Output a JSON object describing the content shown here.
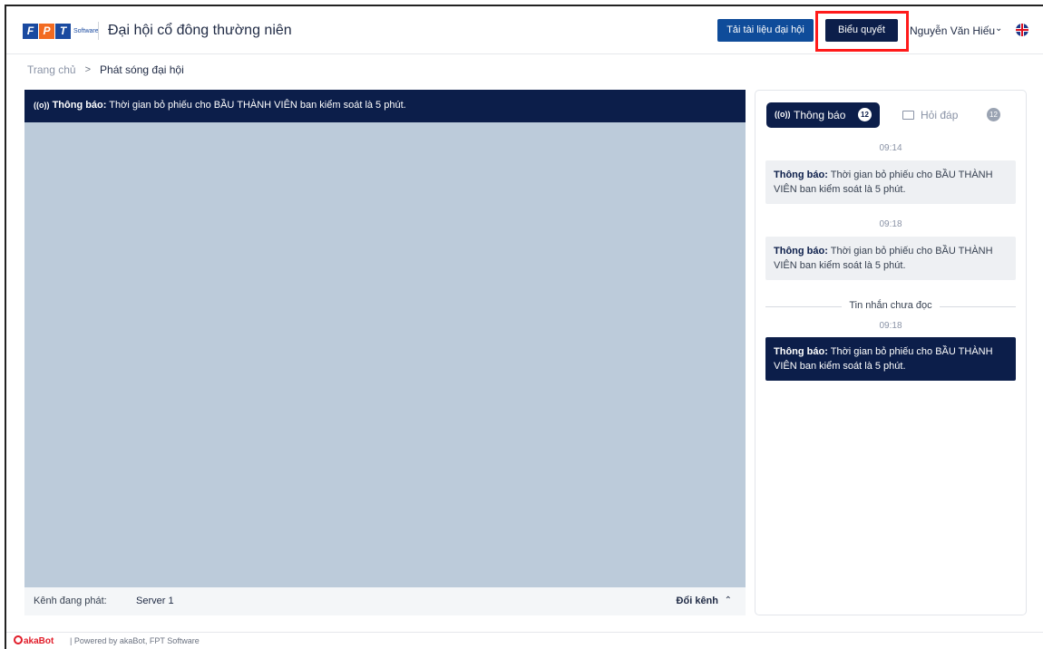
{
  "header": {
    "logo_letters": [
      "F",
      "P",
      "T"
    ],
    "logo_colors": [
      "#1a4aa0",
      "#f26b21",
      "#1a4aa0"
    ],
    "logo_suffix": "Software",
    "title": "Đại hội cổ đông thường niên",
    "download_label": "Tải tài liệu đại hội",
    "vote_label": "Biểu quyết",
    "user_name": "Nguyễn Văn Hiếu",
    "user_dropdown_icon": "chevron-down-icon",
    "language_icon": "uk-flag-icon"
  },
  "breadcrumb": {
    "home": "Trang chủ",
    "separator": ">",
    "current": "Phát sóng đại hội"
  },
  "video": {
    "banner_label": "Thông báo:",
    "banner_text": "Thời gian bỏ phiếu cho BẦU THÀNH VIÊN ban kiểm soát là 5 phút.",
    "channel_label": "Kênh đang phát:",
    "channel_value": "Server 1",
    "switch_label": "Đổi kênh",
    "switch_icon": "chevron-up-icon"
  },
  "panel": {
    "tabs": [
      {
        "label": "Thông báo",
        "count": "12",
        "icon": "broadcast-icon",
        "active": true
      },
      {
        "label": "Hỏi đáp",
        "count": "12",
        "icon": "chat-icon",
        "active": false
      }
    ],
    "messages": [
      {
        "time": "09:14",
        "label": "Thông báo:",
        "text": "Thời gian bỏ phiếu cho BẦU THÀNH VIÊN ban kiểm soát là 5 phút.",
        "read": true
      },
      {
        "time": "09:18",
        "label": "Thông báo:",
        "text": "Thời gian bỏ phiếu cho BẦU THÀNH VIÊN ban kiểm soát là 5 phút.",
        "read": true
      },
      {
        "time": "09:18",
        "label": "Thông báo:",
        "text": "Thời gian bỏ phiếu cho BẦU THÀNH VIÊN ban kiểm soát là 5 phút.",
        "read": false
      }
    ],
    "unread_divider": "Tin nhắn chưa đọc"
  },
  "footer": {
    "brand": "akaBot",
    "powered_by": "Powered by akaBot, FPT Software"
  },
  "colors": {
    "navy": "#0c1e4a",
    "primary_blue": "#0f4c9a",
    "highlight_red": "#ff1a1a",
    "player_bg": "#bccbda"
  }
}
